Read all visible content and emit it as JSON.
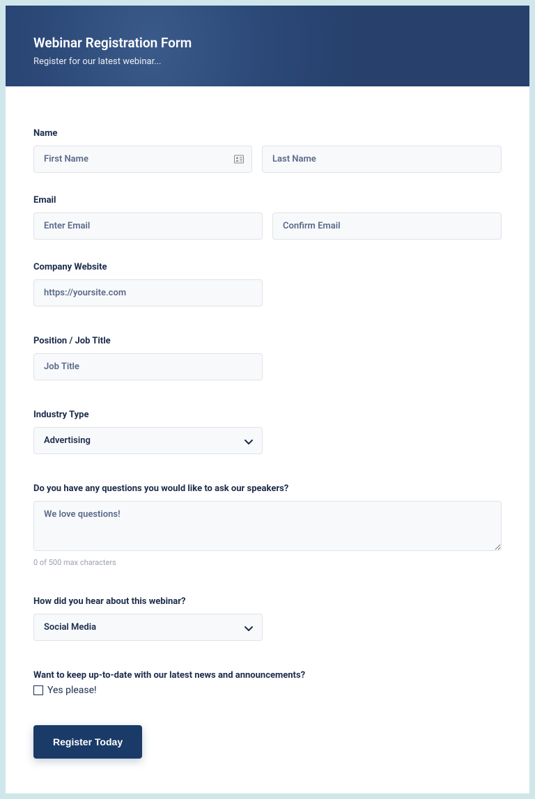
{
  "header": {
    "title": "Webinar Registration Form",
    "subtitle": "Register for our latest webinar..."
  },
  "fields": {
    "name": {
      "label": "Name",
      "first_placeholder": "First Name",
      "last_placeholder": "Last Name"
    },
    "email": {
      "label": "Email",
      "enter_placeholder": "Enter Email",
      "confirm_placeholder": "Confirm Email"
    },
    "website": {
      "label": "Company Website",
      "placeholder": "https://yoursite.com"
    },
    "position": {
      "label": "Position / Job Title",
      "placeholder": "Job Title"
    },
    "industry": {
      "label": "Industry Type",
      "selected": "Advertising"
    },
    "questions": {
      "label": "Do you have any questions you would like to ask our speakers?",
      "placeholder": "We love questions!",
      "hint": "0 of 500 max characters"
    },
    "hear": {
      "label": "How did you hear about this webinar?",
      "selected": "Social Media"
    },
    "subscribe": {
      "label": "Want to keep up-to-date with our latest news and announcements?",
      "option": "Yes please!"
    }
  },
  "submit_label": "Register Today"
}
